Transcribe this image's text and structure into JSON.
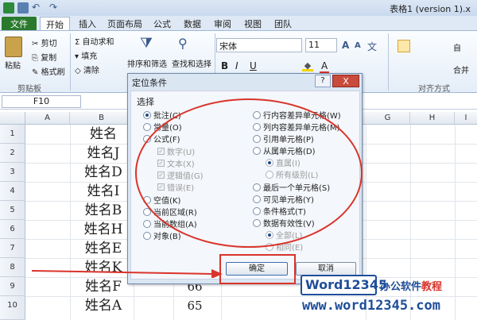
{
  "window": {
    "title": "表格1 (version 1).x"
  },
  "tabs": [
    {
      "label": "文件"
    },
    {
      "label": "开始"
    },
    {
      "label": "插入"
    },
    {
      "label": "页面布局"
    },
    {
      "label": "公式"
    },
    {
      "label": "数据"
    },
    {
      "label": "审阅"
    },
    {
      "label": "视图"
    },
    {
      "label": "团队"
    }
  ],
  "ribbon": {
    "paste": "粘贴",
    "cut": "剪切",
    "copy": "复制",
    "format_painter": "格式刷",
    "clipboard_group": "剪贴板",
    "autosum": "自动求和",
    "fill": "填充",
    "clear": "清除",
    "sort_filter": "排序和筛选",
    "find_select": "查找和选择",
    "font_name": "宋体",
    "font_size": "11",
    "bold": "B",
    "italic": "I",
    "underline": "U",
    "font_color_glyph": "A",
    "font_big_a": "A",
    "font_small_a": "A",
    "wen": "文",
    "alignment_group": "对齐方式",
    "merge": "合并",
    "right_partial": "自"
  },
  "formula_bar": {
    "name_box": "F10"
  },
  "columns": [
    "A",
    "B",
    "C",
    "D",
    "E",
    "F",
    "G",
    "H",
    "I"
  ],
  "rows": [
    {
      "n": "1",
      "name": "姓名",
      "value": ""
    },
    {
      "n": "2",
      "name": "姓名J",
      "value": ""
    },
    {
      "n": "3",
      "name": "姓名D",
      "value": ""
    },
    {
      "n": "4",
      "name": "姓名I",
      "value": ""
    },
    {
      "n": "5",
      "name": "姓名B",
      "value": ""
    },
    {
      "n": "6",
      "name": "姓名H",
      "value": ""
    },
    {
      "n": "7",
      "name": "姓名E",
      "value": ""
    },
    {
      "n": "8",
      "name": "姓名K",
      "value": ""
    },
    {
      "n": "9",
      "name": "姓名F",
      "value": "66"
    },
    {
      "n": "10",
      "name": "姓名A",
      "value": "65"
    }
  ],
  "dialog": {
    "title": "定位条件",
    "help": "?",
    "close": "X",
    "section": "选择",
    "left_options": [
      {
        "label": "批注(C)",
        "kind": "radio",
        "checked": true
      },
      {
        "label": "常量(O)",
        "kind": "radio",
        "checked": false
      },
      {
        "label": "公式(F)",
        "kind": "radio",
        "checked": false
      },
      {
        "label": "数字(U)",
        "kind": "check",
        "checked": true
      },
      {
        "label": "文本(X)",
        "kind": "check",
        "checked": true
      },
      {
        "label": "逻辑值(G)",
        "kind": "check",
        "checked": true
      },
      {
        "label": "错误(E)",
        "kind": "check",
        "checked": true
      },
      {
        "label": "空值(K)",
        "kind": "radio",
        "checked": false
      },
      {
        "label": "当前区域(R)",
        "kind": "radio",
        "checked": false
      },
      {
        "label": "当前数组(A)",
        "kind": "radio",
        "checked": false
      },
      {
        "label": "对象(B)",
        "kind": "radio",
        "checked": false
      }
    ],
    "right_options": [
      {
        "label": "行内容差异单元格(W)",
        "kind": "radio",
        "checked": false
      },
      {
        "label": "列内容差异单元格(M)",
        "kind": "radio",
        "checked": false
      },
      {
        "label": "引用单元格(P)",
        "kind": "radio",
        "checked": false
      },
      {
        "label": "从属单元格(D)",
        "kind": "radio",
        "checked": false
      },
      {
        "label": "直属(I)",
        "kind": "subradio",
        "checked": true
      },
      {
        "label": "所有级别(L)",
        "kind": "subradio",
        "checked": false
      },
      {
        "label": "最后一个单元格(S)",
        "kind": "radio",
        "checked": false
      },
      {
        "label": "可见单元格(Y)",
        "kind": "radio",
        "checked": false
      },
      {
        "label": "条件格式(T)",
        "kind": "radio",
        "checked": false
      },
      {
        "label": "数据有效性(V)",
        "kind": "radio",
        "checked": false
      },
      {
        "label": "全部(L)",
        "kind": "subradio",
        "checked": true
      },
      {
        "label": "相同(E)",
        "kind": "subradio",
        "checked": false
      }
    ],
    "ok": "确定",
    "cancel": "取消"
  },
  "watermark": {
    "brand": "Word12345",
    "tag_blue": "办公软件",
    "tag_red": "教程",
    "url": "www.word12345.com"
  },
  "colors": {
    "annotation": "#d9342b",
    "file_tab": "#2a7a2e",
    "brand": "#1f4e9a"
  }
}
